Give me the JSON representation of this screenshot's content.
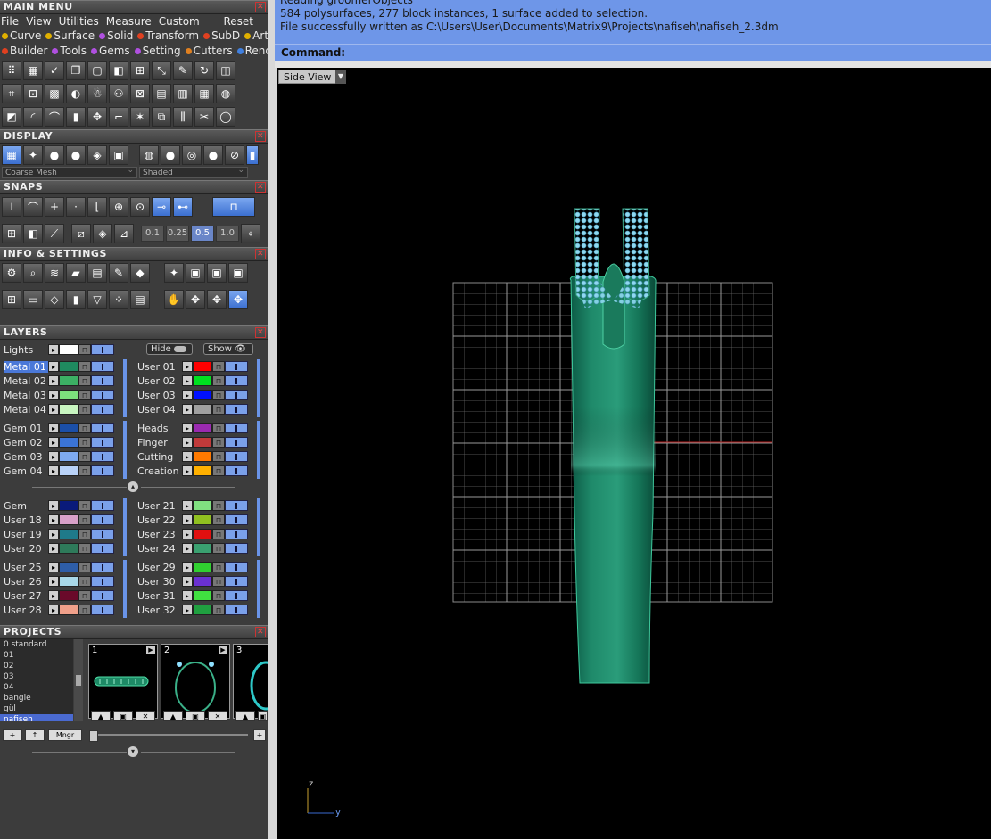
{
  "main_menu": {
    "title": "MAIN MENU",
    "menus": [
      "File",
      "View",
      "Utilities",
      "Measure",
      "Custom"
    ],
    "reset_label": "Reset",
    "tabs_row1": [
      {
        "label": "Curve",
        "color": "#e0b000"
      },
      {
        "label": "Surface",
        "color": "#e0b000"
      },
      {
        "label": "Solid",
        "color": "#b050e0"
      },
      {
        "label": "Transform",
        "color": "#e04020"
      },
      {
        "label": "SubD",
        "color": "#e04020"
      },
      {
        "label": "Art",
        "color": "#e0b000"
      }
    ],
    "tabs_row2": [
      {
        "label": "Builder",
        "color": "#e04020"
      },
      {
        "label": "Tools",
        "color": "#b050e0"
      },
      {
        "label": "Gems",
        "color": "#b050e0"
      },
      {
        "label": "Setting",
        "color": "#b050e0"
      },
      {
        "label": "Cutters",
        "color": "#e08020"
      },
      {
        "label": "Render",
        "color": "#4080e0"
      }
    ]
  },
  "display": {
    "title": "DISPLAY",
    "mesh_select": "Coarse Mesh",
    "shade_select": "Shaded"
  },
  "snaps": {
    "title": "SNAPS",
    "values": [
      "0.1",
      "0.25",
      "0.5",
      "1.0"
    ]
  },
  "info_settings": {
    "title": "INFO & SETTINGS"
  },
  "layers": {
    "title": "LAYERS",
    "lights_label": "Lights",
    "hide_label": "Hide",
    "show_label": "Show",
    "left_groups": [
      [
        {
          "name": "Metal 01",
          "color": "#1f8a5f",
          "selected": true
        },
        {
          "name": "Metal 02",
          "color": "#3cb064"
        },
        {
          "name": "Metal 03",
          "color": "#7de07d"
        },
        {
          "name": "Metal 04",
          "color": "#c8f5c0"
        }
      ],
      [
        {
          "name": "Gem 01",
          "color": "#1b4fa8"
        },
        {
          "name": "Gem 02",
          "color": "#3b74d6"
        },
        {
          "name": "Gem 03",
          "color": "#7eaaf0"
        },
        {
          "name": "Gem 04",
          "color": "#b9d2f8"
        }
      ],
      [
        {
          "name": "Gem",
          "color": "#0a1a7a"
        },
        {
          "name": "User 18",
          "color": "#d8a0c8"
        },
        {
          "name": "User 19",
          "color": "#1f7a8a"
        },
        {
          "name": "User 20",
          "color": "#2e7a5a"
        }
      ],
      [
        {
          "name": "User 25",
          "color": "#2e5ea8"
        },
        {
          "name": "User 26",
          "color": "#a8d8e8"
        },
        {
          "name": "User 27",
          "color": "#6a0a2a"
        },
        {
          "name": "User 28",
          "color": "#f0a08a"
        }
      ]
    ],
    "right_groups": [
      [
        {
          "name": "User 01",
          "color": "#ff0000"
        },
        {
          "name": "User 02",
          "color": "#00e020"
        },
        {
          "name": "User 03",
          "color": "#0010ff"
        },
        {
          "name": "User 04",
          "color": "#a0a0a0"
        }
      ],
      [
        {
          "name": "Heads",
          "color": "#9a2ab0"
        },
        {
          "name": "Finger",
          "color": "#c03a3a"
        },
        {
          "name": "Cutting",
          "color": "#ff7a00"
        },
        {
          "name": "Creation",
          "color": "#ffb000"
        }
      ],
      [
        {
          "name": "User 21",
          "color": "#80e080"
        },
        {
          "name": "User 22",
          "color": "#90c020"
        },
        {
          "name": "User 23",
          "color": "#e01010"
        },
        {
          "name": "User 24",
          "color": "#3aa070"
        }
      ],
      [
        {
          "name": "User 29",
          "color": "#30d030"
        },
        {
          "name": "User 30",
          "color": "#6a30d0"
        },
        {
          "name": "User 31",
          "color": "#40e040"
        },
        {
          "name": "User 32",
          "color": "#20a040"
        }
      ]
    ]
  },
  "projects": {
    "title": "PROJECTS",
    "list": [
      "0 standard",
      "01",
      "02",
      "03",
      "04",
      "bangle",
      "gül",
      "nafiseh"
    ],
    "selected": "nafiseh",
    "thumb_numbers": [
      "1",
      "2",
      "3"
    ],
    "mngr_label": "Mngr"
  },
  "command": {
    "lines": [
      "Reading groomerObjects",
      "584 polysurfaces, 277 block instances, 1 surface added to selection.",
      "File successfully written as C:\\Users\\User\\Documents\\Matrix9\\Projects\\nafiseh\\nafiseh_2.3dm"
    ],
    "prompt_label": "Command:"
  },
  "viewport": {
    "view_name": "Side View",
    "axis_z": "z",
    "axis_y": "y"
  }
}
